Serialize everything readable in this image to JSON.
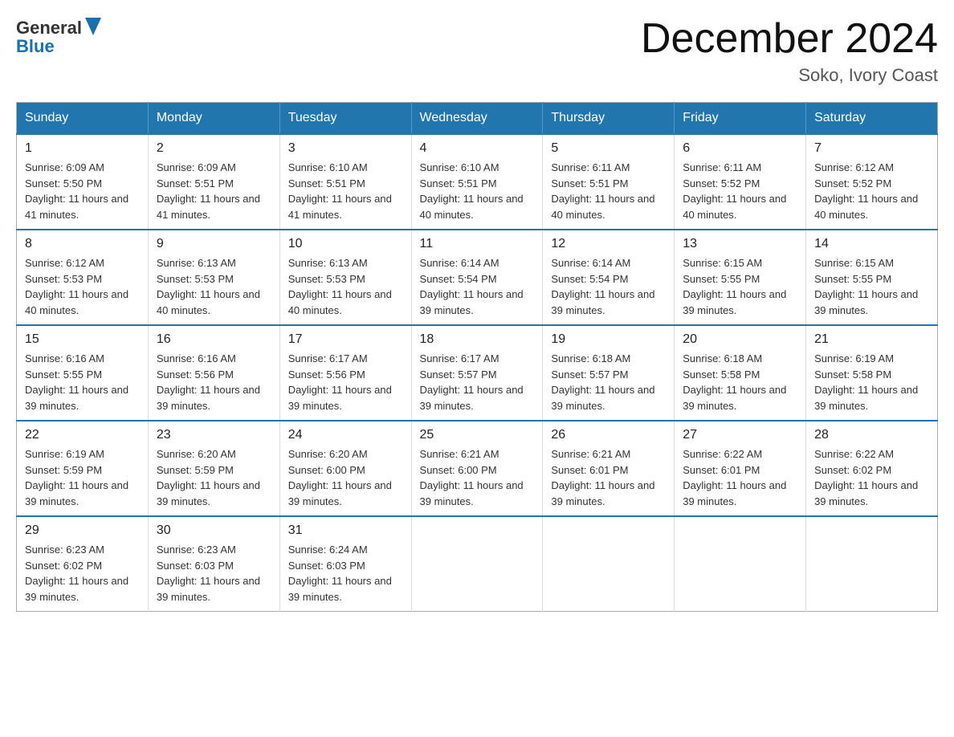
{
  "logo": {
    "general": "General",
    "blue": "Blue"
  },
  "title": "December 2024",
  "location": "Soko, Ivory Coast",
  "days_of_week": [
    "Sunday",
    "Monday",
    "Tuesday",
    "Wednesday",
    "Thursday",
    "Friday",
    "Saturday"
  ],
  "weeks": [
    [
      {
        "day": "1",
        "sunrise": "6:09 AM",
        "sunset": "5:50 PM",
        "daylight": "11 hours and 41 minutes."
      },
      {
        "day": "2",
        "sunrise": "6:09 AM",
        "sunset": "5:51 PM",
        "daylight": "11 hours and 41 minutes."
      },
      {
        "day": "3",
        "sunrise": "6:10 AM",
        "sunset": "5:51 PM",
        "daylight": "11 hours and 41 minutes."
      },
      {
        "day": "4",
        "sunrise": "6:10 AM",
        "sunset": "5:51 PM",
        "daylight": "11 hours and 40 minutes."
      },
      {
        "day": "5",
        "sunrise": "6:11 AM",
        "sunset": "5:51 PM",
        "daylight": "11 hours and 40 minutes."
      },
      {
        "day": "6",
        "sunrise": "6:11 AM",
        "sunset": "5:52 PM",
        "daylight": "11 hours and 40 minutes."
      },
      {
        "day": "7",
        "sunrise": "6:12 AM",
        "sunset": "5:52 PM",
        "daylight": "11 hours and 40 minutes."
      }
    ],
    [
      {
        "day": "8",
        "sunrise": "6:12 AM",
        "sunset": "5:53 PM",
        "daylight": "11 hours and 40 minutes."
      },
      {
        "day": "9",
        "sunrise": "6:13 AM",
        "sunset": "5:53 PM",
        "daylight": "11 hours and 40 minutes."
      },
      {
        "day": "10",
        "sunrise": "6:13 AM",
        "sunset": "5:53 PM",
        "daylight": "11 hours and 40 minutes."
      },
      {
        "day": "11",
        "sunrise": "6:14 AM",
        "sunset": "5:54 PM",
        "daylight": "11 hours and 39 minutes."
      },
      {
        "day": "12",
        "sunrise": "6:14 AM",
        "sunset": "5:54 PM",
        "daylight": "11 hours and 39 minutes."
      },
      {
        "day": "13",
        "sunrise": "6:15 AM",
        "sunset": "5:55 PM",
        "daylight": "11 hours and 39 minutes."
      },
      {
        "day": "14",
        "sunrise": "6:15 AM",
        "sunset": "5:55 PM",
        "daylight": "11 hours and 39 minutes."
      }
    ],
    [
      {
        "day": "15",
        "sunrise": "6:16 AM",
        "sunset": "5:55 PM",
        "daylight": "11 hours and 39 minutes."
      },
      {
        "day": "16",
        "sunrise": "6:16 AM",
        "sunset": "5:56 PM",
        "daylight": "11 hours and 39 minutes."
      },
      {
        "day": "17",
        "sunrise": "6:17 AM",
        "sunset": "5:56 PM",
        "daylight": "11 hours and 39 minutes."
      },
      {
        "day": "18",
        "sunrise": "6:17 AM",
        "sunset": "5:57 PM",
        "daylight": "11 hours and 39 minutes."
      },
      {
        "day": "19",
        "sunrise": "6:18 AM",
        "sunset": "5:57 PM",
        "daylight": "11 hours and 39 minutes."
      },
      {
        "day": "20",
        "sunrise": "6:18 AM",
        "sunset": "5:58 PM",
        "daylight": "11 hours and 39 minutes."
      },
      {
        "day": "21",
        "sunrise": "6:19 AM",
        "sunset": "5:58 PM",
        "daylight": "11 hours and 39 minutes."
      }
    ],
    [
      {
        "day": "22",
        "sunrise": "6:19 AM",
        "sunset": "5:59 PM",
        "daylight": "11 hours and 39 minutes."
      },
      {
        "day": "23",
        "sunrise": "6:20 AM",
        "sunset": "5:59 PM",
        "daylight": "11 hours and 39 minutes."
      },
      {
        "day": "24",
        "sunrise": "6:20 AM",
        "sunset": "6:00 PM",
        "daylight": "11 hours and 39 minutes."
      },
      {
        "day": "25",
        "sunrise": "6:21 AM",
        "sunset": "6:00 PM",
        "daylight": "11 hours and 39 minutes."
      },
      {
        "day": "26",
        "sunrise": "6:21 AM",
        "sunset": "6:01 PM",
        "daylight": "11 hours and 39 minutes."
      },
      {
        "day": "27",
        "sunrise": "6:22 AM",
        "sunset": "6:01 PM",
        "daylight": "11 hours and 39 minutes."
      },
      {
        "day": "28",
        "sunrise": "6:22 AM",
        "sunset": "6:02 PM",
        "daylight": "11 hours and 39 minutes."
      }
    ],
    [
      {
        "day": "29",
        "sunrise": "6:23 AM",
        "sunset": "6:02 PM",
        "daylight": "11 hours and 39 minutes."
      },
      {
        "day": "30",
        "sunrise": "6:23 AM",
        "sunset": "6:03 PM",
        "daylight": "11 hours and 39 minutes."
      },
      {
        "day": "31",
        "sunrise": "6:24 AM",
        "sunset": "6:03 PM",
        "daylight": "11 hours and 39 minutes."
      },
      null,
      null,
      null,
      null
    ]
  ]
}
